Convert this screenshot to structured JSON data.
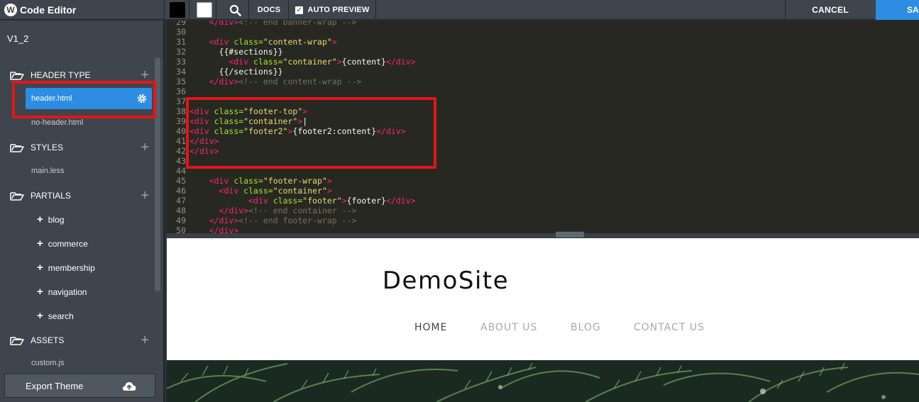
{
  "app": {
    "title": "Code Editor",
    "logo_letter": "W"
  },
  "toolbar": {
    "swatch_dark": "#000000",
    "swatch_light": "#ffffff",
    "search_icon": "search-icon",
    "docs_label": "DOCS",
    "auto_preview_label": "AUTO PREVIEW",
    "auto_preview_checked": true,
    "cancel_label": "CANCEL",
    "save_label": "SA"
  },
  "sidebar": {
    "version": "V1_2",
    "sections": [
      {
        "label": "HEADER TYPE",
        "files": [
          "header.html",
          "no-header.html"
        ],
        "active_file": "header.html"
      },
      {
        "label": "STYLES",
        "files": [
          "main.less"
        ]
      },
      {
        "label": "PARTIALS",
        "folders": [
          "blog",
          "commerce",
          "membership",
          "navigation",
          "search"
        ]
      },
      {
        "label": "ASSETS",
        "files": [
          "custom.js"
        ]
      }
    ],
    "export_label": "Export Theme"
  },
  "editor": {
    "lines": [
      {
        "n": "29",
        "tokens": [
          [
            "tx",
            "    "
          ],
          [
            "tg",
            "</div>"
          ],
          [
            "cm",
            "<!-- end banner-wrap -->"
          ]
        ]
      },
      {
        "n": "30",
        "tokens": []
      },
      {
        "n": "31",
        "tokens": [
          [
            "tx",
            "    "
          ],
          [
            "tg",
            "<div "
          ],
          [
            "at",
            "class="
          ],
          [
            "st",
            "\"content-wrap\""
          ],
          [
            "tg",
            ">"
          ]
        ]
      },
      {
        "n": "32",
        "tokens": [
          [
            "tx",
            "      {{#sections}}"
          ]
        ]
      },
      {
        "n": "33",
        "tokens": [
          [
            "tx",
            "        "
          ],
          [
            "tg",
            "<div "
          ],
          [
            "at",
            "class="
          ],
          [
            "st",
            "\"container\""
          ],
          [
            "tg",
            ">"
          ],
          [
            "tx",
            "{content}"
          ],
          [
            "tg",
            "</div>"
          ]
        ]
      },
      {
        "n": "34",
        "tokens": [
          [
            "tx",
            "      {{/sections}}"
          ]
        ]
      },
      {
        "n": "35",
        "tokens": [
          [
            "tx",
            "    "
          ],
          [
            "tg",
            "</div>"
          ],
          [
            "cm",
            "<!-- end content-wrap -->"
          ]
        ]
      },
      {
        "n": "36",
        "tokens": []
      },
      {
        "n": "37",
        "tokens": []
      },
      {
        "n": "38",
        "tokens": [
          [
            "tg",
            "<div "
          ],
          [
            "at",
            "class="
          ],
          [
            "st",
            "\"footer-top\""
          ],
          [
            "tg",
            ">"
          ]
        ]
      },
      {
        "n": "39",
        "tokens": [
          [
            "tg",
            "<div "
          ],
          [
            "at",
            "class="
          ],
          [
            "st",
            "\"container\""
          ],
          [
            "tg",
            ">"
          ],
          [
            "tx",
            "|"
          ]
        ]
      },
      {
        "n": "40",
        "tokens": [
          [
            "tg",
            "<div "
          ],
          [
            "at",
            "class="
          ],
          [
            "st",
            "\"footer2\""
          ],
          [
            "tg",
            ">"
          ],
          [
            "tx",
            "{footer2:content}"
          ],
          [
            "tg",
            "</div>"
          ]
        ]
      },
      {
        "n": "41",
        "tokens": [
          [
            "tg",
            "</div>"
          ]
        ]
      },
      {
        "n": "42",
        "tokens": [
          [
            "tg",
            "</div>"
          ]
        ]
      },
      {
        "n": "43",
        "tokens": []
      },
      {
        "n": "44",
        "tokens": []
      },
      {
        "n": "45",
        "tokens": [
          [
            "tx",
            "    "
          ],
          [
            "tg",
            "<div "
          ],
          [
            "at",
            "class="
          ],
          [
            "st",
            "\"footer-wrap\""
          ],
          [
            "tg",
            ">"
          ]
        ]
      },
      {
        "n": "46",
        "tokens": [
          [
            "tx",
            "      "
          ],
          [
            "tg",
            "<div "
          ],
          [
            "at",
            "class="
          ],
          [
            "st",
            "\"container\""
          ],
          [
            "tg",
            ">"
          ]
        ]
      },
      {
        "n": "47",
        "tokens": [
          [
            "tx",
            "            "
          ],
          [
            "tg",
            "<div "
          ],
          [
            "at",
            "class="
          ],
          [
            "st",
            "\"footer\""
          ],
          [
            "tg",
            ">"
          ],
          [
            "tx",
            "{footer}"
          ],
          [
            "tg",
            "</div>"
          ]
        ]
      },
      {
        "n": "48",
        "tokens": [
          [
            "tx",
            "      "
          ],
          [
            "tg",
            "</div>"
          ],
          [
            "cm",
            "<!-- end container -->"
          ]
        ]
      },
      {
        "n": "49",
        "tokens": [
          [
            "tx",
            "    "
          ],
          [
            "tg",
            "</div>"
          ],
          [
            "cm",
            "<!-- end footer-wrap -->"
          ]
        ]
      },
      {
        "n": "50",
        "tokens": [
          [
            "tx",
            "    "
          ],
          [
            "tg",
            "</div>"
          ]
        ]
      }
    ]
  },
  "preview": {
    "site_title": "DemoSite",
    "nav": [
      "HOME",
      "ABOUT US",
      "BLOG",
      "CONTACT US"
    ],
    "active_nav": "HOME"
  },
  "colors": {
    "accent": "#2d8de2",
    "highlight": "#e3151a",
    "sidebar_bg": "#3e454c",
    "editor_bg": "#272822"
  }
}
